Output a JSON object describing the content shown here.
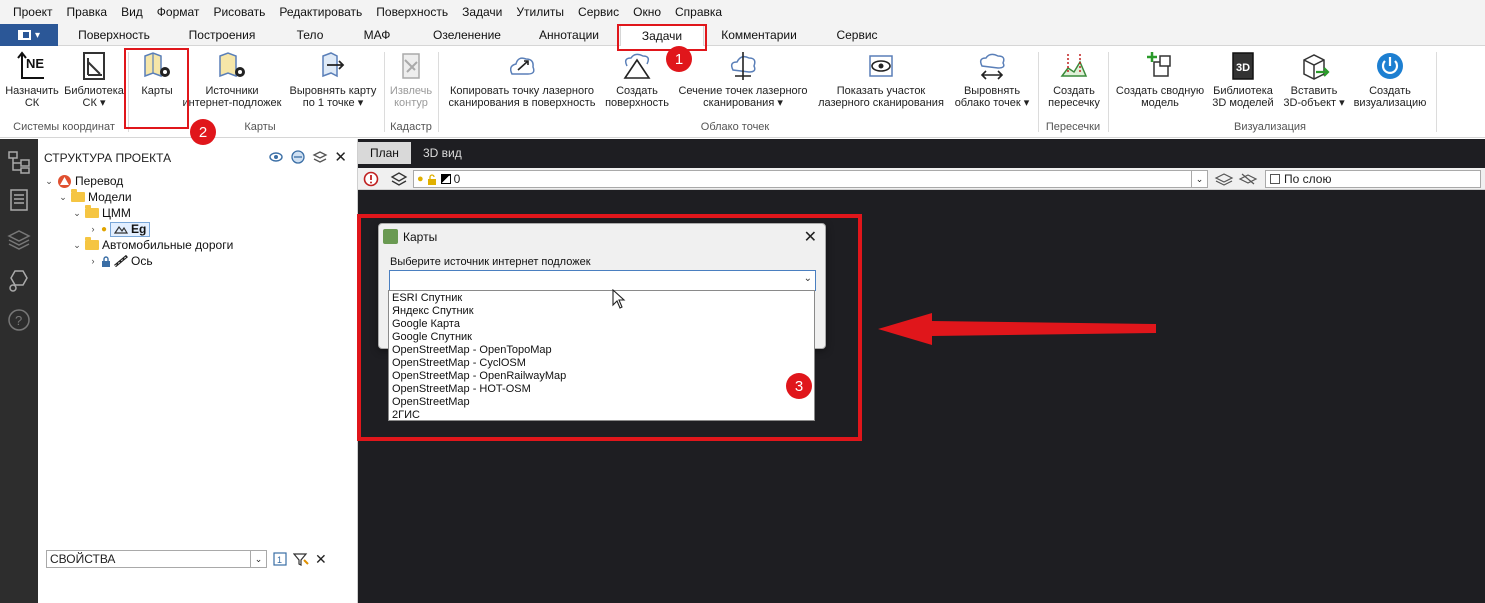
{
  "menu": [
    "Проект",
    "Правка",
    "Вид",
    "Формат",
    "Рисовать",
    "Редактировать",
    "Поверхность",
    "Задачи",
    "Утилиты",
    "Сервис",
    "Окно",
    "Справка"
  ],
  "tabs": [
    "Поверхность",
    "Построения",
    "Тело",
    "МАФ",
    "Озеленение",
    "Аннотации",
    "Задачи",
    "Комментарии",
    "Сервис"
  ],
  "active_tab": "Задачи",
  "ribbon": {
    "buttons": [
      {
        "label1": "Назначить",
        "label2": "СК"
      },
      {
        "label1": "Библиотека",
        "label2": "СК ▾"
      },
      {
        "label1": "Карты",
        "label2": ""
      },
      {
        "label1": "Источники",
        "label2": "интернет-подложек"
      },
      {
        "label1": "Выровнять карту",
        "label2": "по 1 точке ▾"
      },
      {
        "label1": "Извлечь",
        "label2": "контур"
      },
      {
        "label1": "Копировать точку лазерного",
        "label2": "сканирования в поверхность"
      },
      {
        "label1": "Создать",
        "label2": "поверхность"
      },
      {
        "label1": "Сечение точек лазерного",
        "label2": "сканирования ▾"
      },
      {
        "label1": "Показать участок",
        "label2": "лазерного сканирования"
      },
      {
        "label1": "Выровнять",
        "label2": "облако точек ▾"
      },
      {
        "label1": "Создать",
        "label2": "пересечку"
      },
      {
        "label1": "Создать сводную",
        "label2": "модель"
      },
      {
        "label1": "Библиотека",
        "label2": "3D моделей"
      },
      {
        "label1": "Вставить",
        "label2": "3D-объект ▾"
      },
      {
        "label1": "Создать",
        "label2": "визуализацию"
      }
    ],
    "groups": [
      "Системы координат",
      "Карты",
      "Кадастр",
      "Облако точек",
      "Пересечки",
      "Визуализация"
    ]
  },
  "project": {
    "title": "СТРУКТУРА ПРОЕКТА",
    "tree": {
      "root": "Перевод",
      "models": "Модели",
      "dem": "ЦММ",
      "surface": "Eg",
      "roads": "Автомобильные дороги",
      "axis": "Ось"
    },
    "properties": "СВОЙСТВА"
  },
  "viewport": {
    "tabs": [
      "План",
      "3D вид"
    ],
    "layer_value": "0",
    "linetype": "По слою"
  },
  "dialog": {
    "title": "Карты",
    "label": "Выберите источник интернет подложек",
    "options": [
      "ESRI Спутник",
      "Яндекс Спутник",
      "Google Карта",
      "Google Спутник",
      "OpenStreetMap - OpenTopoMap",
      "OpenStreetMap - CyclOSM",
      "OpenStreetMap - OpenRailwayMap",
      "OpenStreetMap - HOT-OSM",
      "OpenStreetMap",
      "2ГИС"
    ]
  },
  "annotations": {
    "badge1": "1",
    "badge2": "2",
    "badge3": "3"
  },
  "colors": {
    "accent": "#2b5797",
    "annotation": "#e0161b",
    "viewport_bg": "#1e1e22"
  }
}
